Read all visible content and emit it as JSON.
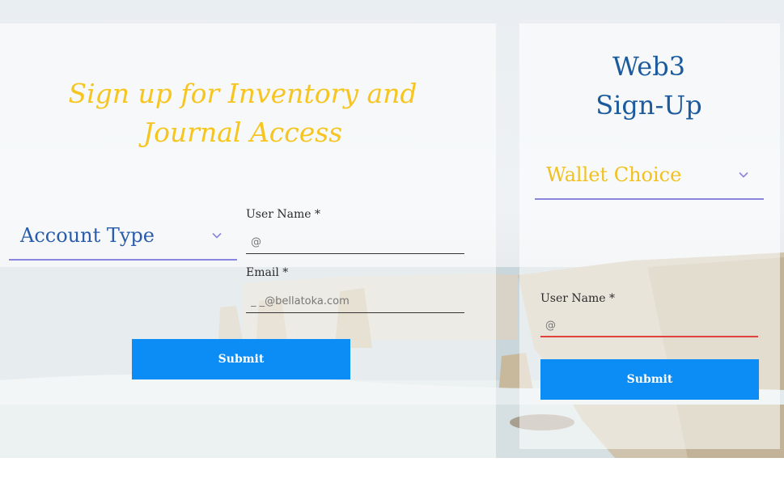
{
  "left_form": {
    "title": "Sign up for Inventory and Journal Access",
    "account_type": {
      "value": "Account Type"
    },
    "username": {
      "label": "User Name *",
      "placeholder": "@"
    },
    "email": {
      "label": "Email *",
      "placeholder": "_ _@bellatoka.com"
    },
    "submit_label": "Submit"
  },
  "right_form": {
    "title_line1": "Web3",
    "title_line2": "Sign-Up",
    "wallet_choice": {
      "value": "Wallet Choice"
    },
    "username": {
      "label": "User Name *",
      "placeholder": "@"
    },
    "submit_label": "Submit"
  },
  "colors": {
    "title_yellow": "#f7c520",
    "title_blue": "#1b5a9c",
    "button_blue": "#0c8cf5",
    "dropdown_underline": "#8a85df",
    "active_field_underline": "#e0433d"
  },
  "icons": {
    "dropdown": "chevron-down-icon"
  }
}
